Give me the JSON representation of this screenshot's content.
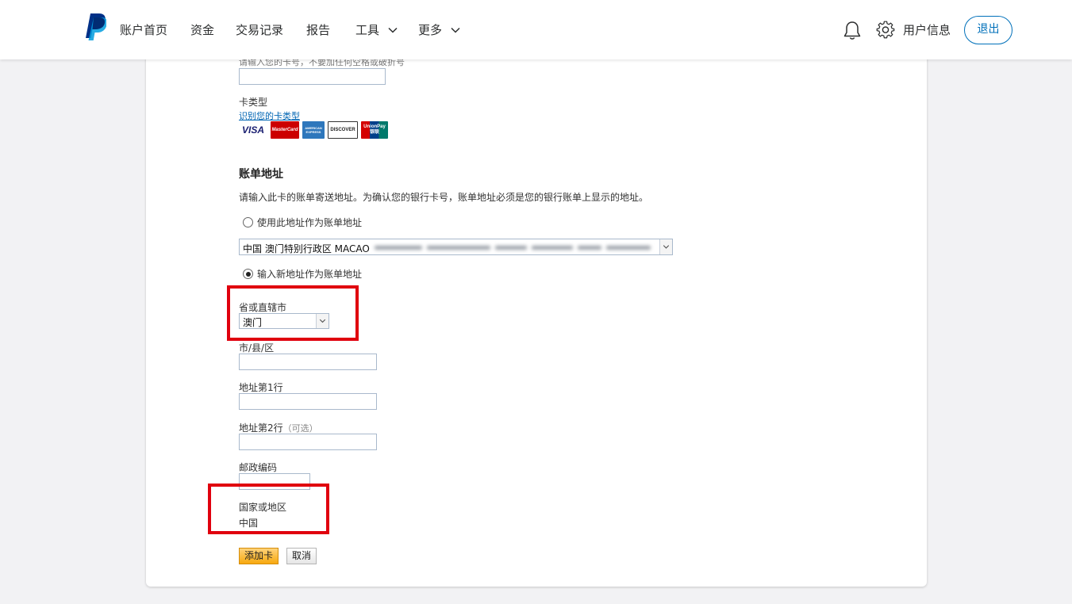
{
  "header": {
    "nav": [
      {
        "label": "账户首页"
      },
      {
        "label": "资金"
      },
      {
        "label": "交易记录"
      },
      {
        "label": "报告"
      },
      {
        "label": "工具",
        "dropdown": true
      },
      {
        "label": "更多",
        "dropdown": true
      }
    ],
    "profile_label": "用户信息",
    "logout_label": "退出",
    "brand_color": "#003087",
    "accent_color": "#0070ba"
  },
  "form": {
    "card_number_hint": "请输入您的卡号，不要加任何空格或破折号",
    "card_type_label": "卡类型",
    "card_type_link": "识别您的卡类型",
    "card_brands": [
      "VISA",
      "MasterCard",
      "AMERICAN EXPRESS",
      "DISCOVER",
      "UnionPay 银联"
    ],
    "billing_title": "账单地址",
    "billing_desc": "请输入此卡的账单寄送地址。为确认您的银行卡号，账单地址必须是您的银行账单上显示的地址。",
    "use_address_option": "使用此地址作为账单地址",
    "saved_address_value": "中国 澳门特别行政区 MACAO",
    "new_address_option": "输入新地址作为账单地址",
    "province_label": "省或直辖市",
    "province_value": "澳门",
    "city_label": "市/县/区",
    "address1_label": "地址第1行",
    "address2_label": "地址第2行",
    "address2_optional": "（可选）",
    "postal_label": "邮政编码",
    "country_label": "国家或地区",
    "country_value": "中国",
    "add_card_button": "添加卡",
    "cancel_button": "取消",
    "highlight_color": "#e0000e"
  }
}
